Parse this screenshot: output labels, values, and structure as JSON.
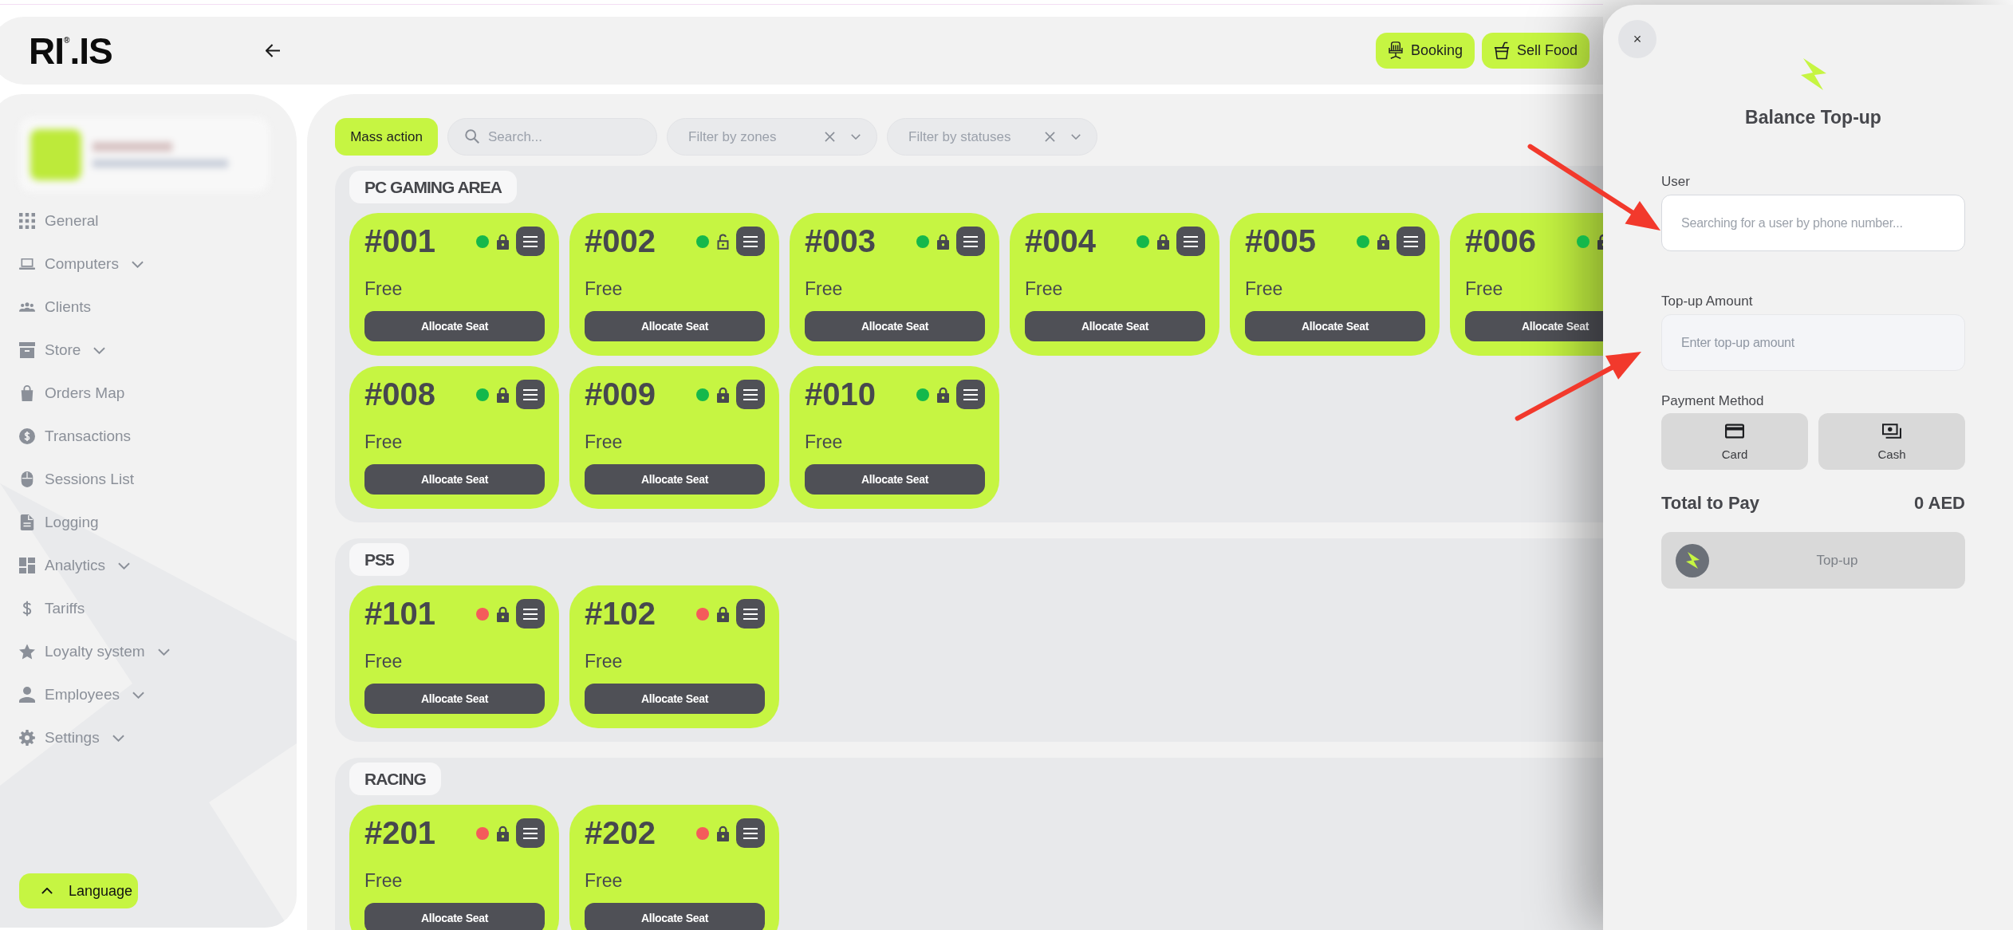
{
  "header": {
    "logo": "RI$^{®}$.IS",
    "actions": [
      {
        "label": "Booking"
      },
      {
        "label": "Sell Food"
      }
    ]
  },
  "sidebar": {
    "items": [
      {
        "label": "General",
        "kind": "link",
        "selected": false
      },
      {
        "label": "Computers",
        "kind": "group",
        "selected": false
      },
      {
        "label": "Clients",
        "kind": "link",
        "selected": false
      },
      {
        "label": "Store",
        "kind": "group",
        "selected": false
      },
      {
        "label": "Orders Map",
        "kind": "link",
        "selected": false
      },
      {
        "label": "Transactions",
        "kind": "link",
        "selected": false
      },
      {
        "label": "Sessions List",
        "kind": "link",
        "selected": false
      },
      {
        "label": "Logging",
        "kind": "link",
        "selected": false
      },
      {
        "label": "Analytics",
        "kind": "group",
        "selected": false
      },
      {
        "label": "Tariffs",
        "kind": "link",
        "selected": false
      },
      {
        "label": "Loyalty system",
        "kind": "group",
        "selected": false
      },
      {
        "label": "Employees",
        "kind": "group",
        "selected": false
      },
      {
        "label": "Settings",
        "kind": "group",
        "selected": false
      }
    ],
    "language_button": "Language"
  },
  "toolbar": {
    "mass_action": "Mass action",
    "search": {
      "placeholder": "Search..."
    },
    "filters": [
      {
        "placeholder": "Filter by zones"
      },
      {
        "placeholder": "Filter by statuses"
      }
    ]
  },
  "zones": [
    {
      "name": "PC GAMING AREA",
      "seats": [
        {
          "number": "#001",
          "color": "#14b84b",
          "locked": true,
          "status": "Free",
          "action": "Allocate Seat"
        },
        {
          "number": "#002",
          "color": "#14b84b",
          "locked": false,
          "status": "Free",
          "action": "Allocate Seat"
        },
        {
          "number": "#003",
          "color": "#14b84b",
          "locked": true,
          "status": "Free",
          "action": "Allocate Seat"
        },
        {
          "number": "#004",
          "color": "#14b84b",
          "locked": true,
          "status": "Free",
          "action": "Allocate Seat"
        },
        {
          "number": "#005",
          "color": "#14b84b",
          "locked": true,
          "status": "Free",
          "action": "Allocate Seat"
        },
        {
          "number": "#006",
          "color": "#14b84b",
          "locked": true,
          "status": "Free",
          "action": "Allocate Seat"
        },
        {
          "number": "#008",
          "color": "#14b84b",
          "locked": true,
          "status": "Free",
          "action": "Allocate Seat"
        },
        {
          "number": "#009",
          "color": "#14b84b",
          "locked": true,
          "status": "Free",
          "action": "Allocate Seat"
        },
        {
          "number": "#010",
          "color": "#14b84b",
          "locked": true,
          "status": "Free",
          "action": "Allocate Seat"
        }
      ]
    },
    {
      "name": "PS5",
      "seats": [
        {
          "number": "#101",
          "color": "#f45b5b",
          "locked": true,
          "status": "Free",
          "action": "Allocate Seat"
        },
        {
          "number": "#102",
          "color": "#f45b5b",
          "locked": true,
          "status": "Free",
          "action": "Allocate Seat"
        }
      ]
    },
    {
      "name": "RACING",
      "seats": [
        {
          "number": "#201",
          "color": "#f45b5b",
          "locked": true,
          "status": "Free",
          "action": "Allocate Seat"
        },
        {
          "number": "#202",
          "color": "#f45b5b",
          "locked": true,
          "status": "Free",
          "action": "Allocate Seat"
        }
      ]
    }
  ],
  "top_up_panel": {
    "close": "×",
    "title": "Balance Top-up",
    "fields": [
      {
        "label": "User",
        "placeholder": "Searching for a user by phone number...",
        "focused": true
      },
      {
        "label": "Top-up Amount",
        "placeholder": "Enter top-up amount",
        "focused": false
      }
    ],
    "payment_method": {
      "label": "Payment Method",
      "options": [
        {
          "label": "Card",
          "kind": "card",
          "selected": false
        },
        {
          "label": "Cash",
          "kind": "cash",
          "selected": false
        }
      ]
    },
    "total": {
      "label": "Total to Pay",
      "value": "0 AED"
    },
    "submit": {
      "label": "Top-up",
      "disabled": true
    }
  }
}
